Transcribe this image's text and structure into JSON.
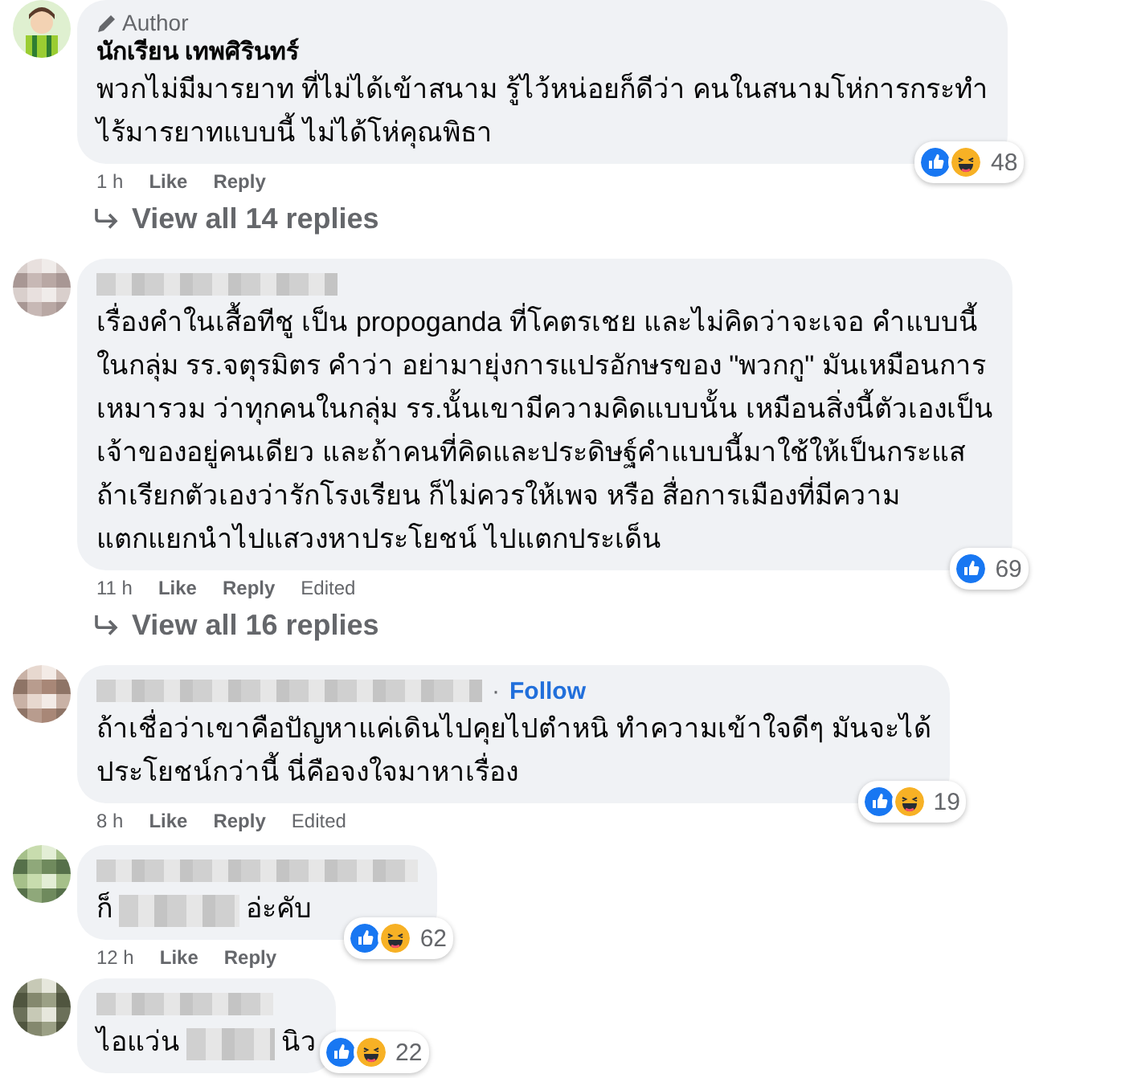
{
  "comments": [
    {
      "author": {
        "kind": "name",
        "text": "นักเรียน เทพศิรินทร์"
      },
      "badge": "Author",
      "body": [
        {
          "kind": "text",
          "text": "พวกไม่มีมารยาท ที่ไม่ได้เข้าสนาม รู้ไว้หน่อยก็ดีว่า คนในสนามโห่การกระทำ\nไร้มารยาทแบบนี้ ไม่ได้โห่คุณพิธา"
        }
      ],
      "meta": [
        "1 h",
        "Like",
        "Reply"
      ],
      "reactions": {
        "like": true,
        "haha": true,
        "count": "48"
      },
      "replies_link": "View all 14 replies"
    },
    {
      "author": {
        "kind": "redacted"
      },
      "body": [
        {
          "kind": "text",
          "text": "เรื่องคำในเสื้อทีชู เป็น propoganda ที่โคตรเชย และไม่คิดว่าจะเจอ คำแบบนี้\nในกลุ่ม รร.จตุรมิตร คำว่า อย่ามายุ่งการแปรอักษรของ \"พวกกู\" มันเหมือนการ\nเหมารวม ว่าทุกคนในกลุ่ม รร.นั้นเขามีความคิดแบบนั้น เหมือนสิ่งนี้ตัวเองเป็น\nเจ้าของอยู่คนเดียว และถ้าคนที่คิดและประดิษฐ์คำแบบนี้มาใช้ให้เป็นกระแส\nถ้าเรียกตัวเองว่ารักโรงเรียน ก็ไม่ควรให้เพจ หรือ สื่อการเมืองที่มีความ\nแตกแยกนำไปแสวงหาประโยชน์ ไปแตกประเด็น"
        }
      ],
      "meta": [
        "11 h",
        "Like",
        "Reply",
        "Edited"
      ],
      "reactions": {
        "like": true,
        "haha": false,
        "count": "69"
      },
      "replies_link": "View all 16 replies"
    },
    {
      "author": {
        "kind": "redacted"
      },
      "separator": "·",
      "follow": "Follow",
      "body": [
        {
          "kind": "text",
          "text": "ถ้าเชื่อว่าเขาคือปัญหาแค่เดินไปคุยไปตำหนิ ทำความเข้าใจดีๆ มันจะได้\nประโยชน์กว่านี้ นี่คือจงใจมาหาเรื่อง"
        }
      ],
      "meta": [
        "8 h",
        "Like",
        "Reply",
        "Edited"
      ],
      "reactions": {
        "like": true,
        "haha": true,
        "count": "19"
      }
    },
    {
      "author": {
        "kind": "redacted"
      },
      "body": [
        {
          "kind": "text",
          "text": "ก็"
        },
        {
          "kind": "redacted"
        },
        {
          "kind": "text",
          "text": "อ่ะคับ"
        }
      ],
      "meta": [
        "12 h",
        "Like",
        "Reply"
      ],
      "reactions": {
        "like": true,
        "haha": true,
        "count": "62"
      }
    },
    {
      "author": {
        "kind": "redacted"
      },
      "body": [
        {
          "kind": "text",
          "text": "ไอแว่น"
        },
        {
          "kind": "redacted"
        },
        {
          "kind": "text",
          "text": "นิว"
        }
      ],
      "reactions": {
        "like": true,
        "haha": true,
        "count": "22"
      }
    }
  ]
}
